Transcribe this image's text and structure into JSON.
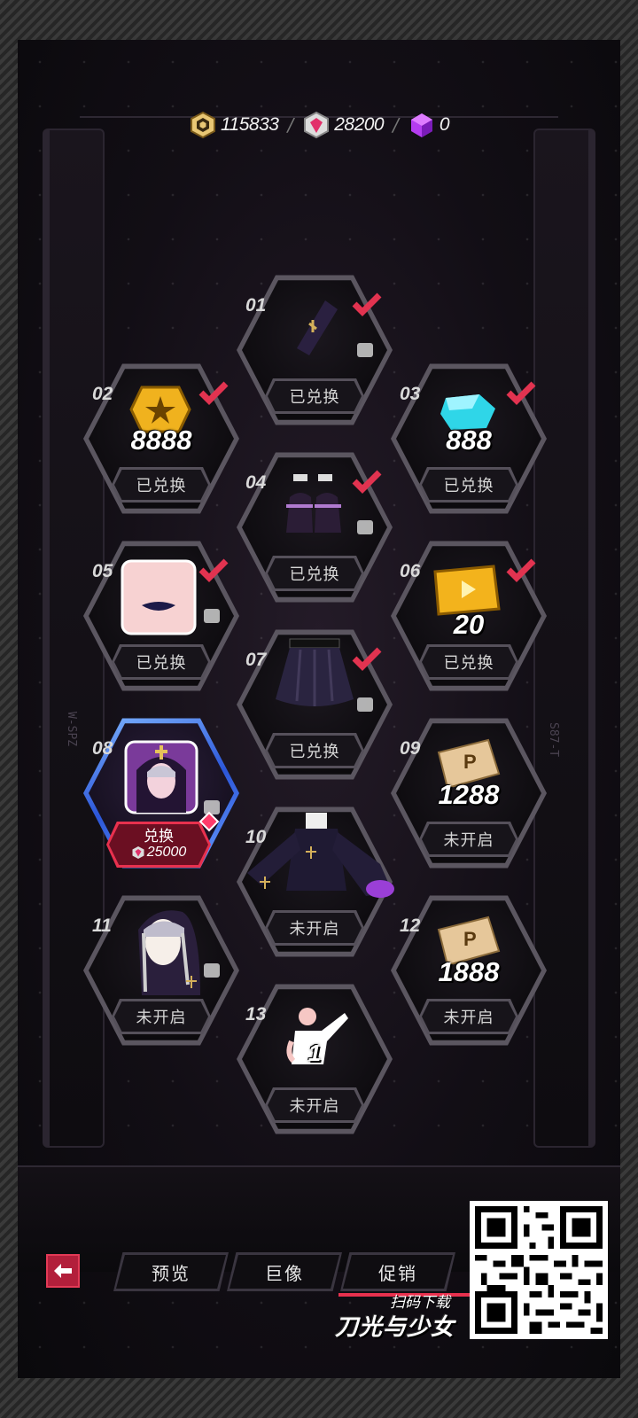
{
  "currency": [
    {
      "icon": "gold-hex-coin-icon",
      "value": "115833"
    },
    {
      "icon": "crystal-gem-icon",
      "value": "28200"
    },
    {
      "icon": "purple-cube-icon",
      "value": "0"
    }
  ],
  "separator": "/",
  "slots": [
    {
      "num": "01",
      "status": "已兑换",
      "item": "sleeve-glove-icon",
      "qty": "",
      "checked": true
    },
    {
      "num": "02",
      "status": "已兑换",
      "item": "gold-coin-icon",
      "qty": "8888",
      "checked": true
    },
    {
      "num": "03",
      "status": "已兑换",
      "item": "blue-crystal-icon",
      "qty": "888",
      "checked": true
    },
    {
      "num": "04",
      "status": "已兑换",
      "item": "black-heels-icon",
      "qty": "",
      "checked": true
    },
    {
      "num": "05",
      "status": "已兑换",
      "item": "lipstick-face-icon",
      "qty": "",
      "checked": true
    },
    {
      "num": "06",
      "status": "已兑换",
      "item": "gold-ticket-box-icon",
      "qty": "20",
      "checked": true
    },
    {
      "num": "07",
      "status": "已兑换",
      "item": "skirt-icon",
      "qty": "",
      "checked": true
    },
    {
      "num": "08",
      "status": "",
      "item": "nun-portrait-icon",
      "qty": "",
      "checked": false
    },
    {
      "num": "09",
      "status": "未开启",
      "item": "ticket-p-icon",
      "qty": "1288",
      "checked": false
    },
    {
      "num": "10",
      "status": "未开启",
      "item": "nun-dress-icon",
      "qty": "",
      "checked": false
    },
    {
      "num": "11",
      "status": "未开启",
      "item": "nun-veil-icon",
      "qty": "",
      "checked": false
    },
    {
      "num": "12",
      "status": "未开启",
      "item": "ticket-p-icon",
      "qty": "1888",
      "checked": false
    },
    {
      "num": "13",
      "status": "未开启",
      "item": "pose-action-icon",
      "qty": "1",
      "checked": false
    }
  ],
  "redeem": {
    "label": "兑换",
    "cost": "25000",
    "cost_icon": "crystal-gem-icon"
  },
  "side_labels": {
    "left": "W-SPZ",
    "right": "S87-T"
  },
  "nav": {
    "back": "back-arrow-icon",
    "tabs": [
      "预览",
      "巨像",
      "促销"
    ],
    "active_tab": "促销"
  },
  "promo": {
    "scan": "扫码下载",
    "brand": "刀光与少女"
  },
  "colors": {
    "accent": "#e8314e",
    "active_frame": "#3e6cf0",
    "check": "#e23350"
  }
}
